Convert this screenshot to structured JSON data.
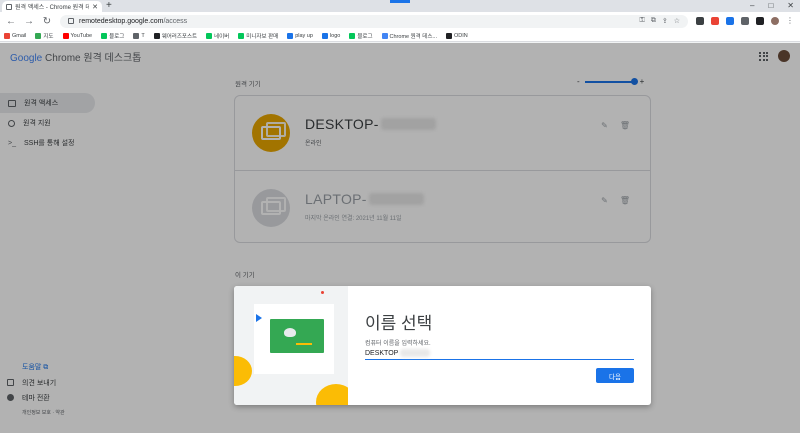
{
  "browser": {
    "tab_title": "원격 액세스 - Chrome 원격 데스...",
    "new_tab": "+",
    "url_host": "remotedesktop.google.com",
    "url_path": "/access",
    "window_controls": [
      "–",
      "□",
      "✕"
    ],
    "bookmarks": [
      {
        "label": "Gmail",
        "color": "#ea4335"
      },
      {
        "label": "지도",
        "color": "#34a853"
      },
      {
        "label": "YouTube",
        "color": "#ff0000"
      },
      {
        "label": "블로그",
        "color": "#03c75a"
      },
      {
        "label": "T",
        "color": "#5f6368"
      },
      {
        "label": "웨어러즈포스트",
        "color": "#202124"
      },
      {
        "label": "네이버",
        "color": "#03c75a"
      },
      {
        "label": "미니자보 판매",
        "color": "#03c75a"
      },
      {
        "label": "play up",
        "color": "#1a73e8"
      },
      {
        "label": "logo",
        "color": "#1a73e8"
      },
      {
        "label": "블로그",
        "color": "#03c75a"
      },
      {
        "label": "Chrome 원격 데스...",
        "color": "#4285f4"
      },
      {
        "label": "ODIN",
        "color": "#202124"
      }
    ]
  },
  "app": {
    "brand_google": "Google",
    "brand_product": "Chrome 원격 데스크톱"
  },
  "sidebar": {
    "items": [
      {
        "label": "원격 액세스",
        "active": true
      },
      {
        "label": "원격 지원",
        "active": false
      },
      {
        "label": "SSH를 통해 설정",
        "active": false
      }
    ],
    "help": "도움말 ⧉",
    "feedback": "의견 보내기",
    "theme": "테마 전환",
    "legal": "개인정보 보호 · 약관"
  },
  "main": {
    "remote_label": "원격 기기",
    "this_label": "이 기기",
    "zoom_minus": "-",
    "zoom_plus": "+",
    "zoom_level": 1.0,
    "devices": [
      {
        "name": "DESKTOP-",
        "status": "온라인",
        "icon_color": "#e8a700",
        "online": true
      },
      {
        "name": "LAPTOP-",
        "status": "마지막 온라인 연결: 2021년 11월 11일",
        "icon_color": "#dadce0",
        "online": false
      }
    ]
  },
  "dialog": {
    "title": "이름 선택",
    "label": "컴퓨터 이름을 입력하세요.",
    "input_value": "DESKTOP",
    "next_button": "다음"
  },
  "colors": {
    "accent": "#1a73e8",
    "online_icon": "#e8a700"
  }
}
